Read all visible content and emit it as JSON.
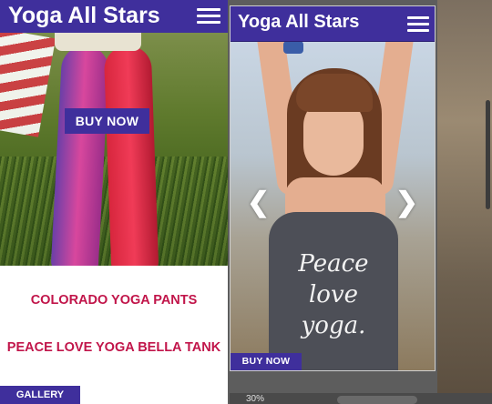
{
  "left_phone": {
    "brand": "Yoga All Stars",
    "menu_icon": "hamburger-icon",
    "hero_button": "BUY NOW",
    "products": [
      "COLORADO YOGA PANTS",
      "PEACE LOVE YOGA BELLA TANK"
    ],
    "gallery_label": "GALLERY"
  },
  "right_phone": {
    "brand": "Yoga All Stars",
    "menu_icon": "hamburger-icon",
    "tank_print": [
      "Peace",
      "love",
      "yoga."
    ],
    "prev_icon": "chevron-left-icon",
    "next_icon": "chevron-right-icon",
    "prev_glyph": "❮",
    "next_glyph": "❯",
    "hero_button": "BUY NOW"
  },
  "footer": {
    "zoom": "30%"
  },
  "colors": {
    "brand_purple": "#3f2f9c",
    "product_link": "#c1154a"
  }
}
